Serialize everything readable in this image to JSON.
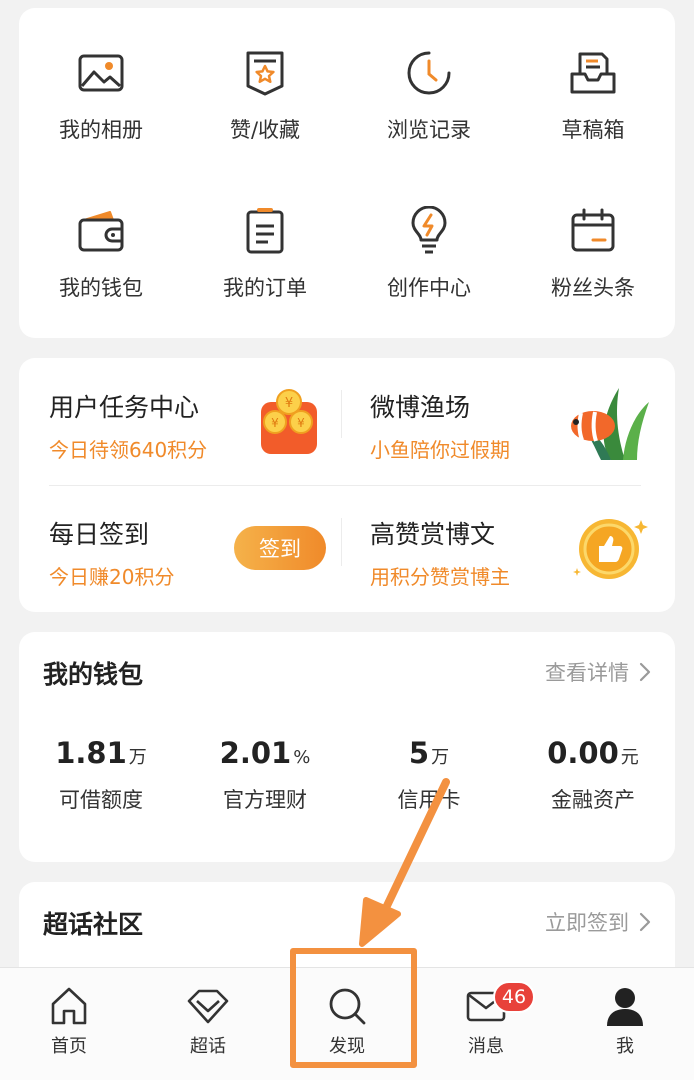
{
  "grid": {
    "items": [
      {
        "label": "我的相册",
        "icon": "photo-album-icon"
      },
      {
        "label": "赞/收藏",
        "icon": "like-favorite-icon"
      },
      {
        "label": "浏览记录",
        "icon": "history-icon"
      },
      {
        "label": "草稿箱",
        "icon": "drafts-icon"
      },
      {
        "label": "我的钱包",
        "icon": "wallet-icon"
      },
      {
        "label": "我的订单",
        "icon": "orders-icon"
      },
      {
        "label": "创作中心",
        "icon": "creator-center-icon"
      },
      {
        "label": "粉丝头条",
        "icon": "fans-headline-icon"
      }
    ]
  },
  "tasks": {
    "user_task": {
      "title": "用户任务中心",
      "subtitle": "今日待领640积分",
      "icon": "coins-icon"
    },
    "fishing": {
      "title": "微博渔场",
      "subtitle": "小鱼陪你过假期",
      "icon": "fish-icon"
    },
    "checkin": {
      "title": "每日签到",
      "subtitle": "今日赚20积分",
      "button": "签到"
    },
    "reward": {
      "title": "高赞赏博文",
      "subtitle": "用积分赞赏博主",
      "icon": "thumbs-up-coin-icon"
    }
  },
  "wallet": {
    "title": "我的钱包",
    "link": "查看详情",
    "stats": [
      {
        "value": "1.81",
        "unit": "万",
        "label": "可借额度"
      },
      {
        "value": "2.01",
        "unit": "%",
        "label": "官方理财"
      },
      {
        "value": "5",
        "unit": "万",
        "label": "信用卡"
      },
      {
        "value": "0.00",
        "unit": "元",
        "label": "金融资产"
      }
    ]
  },
  "topic": {
    "title": "超话社区",
    "link": "立即签到"
  },
  "nav": {
    "items": [
      {
        "label": "首页",
        "icon": "home-icon"
      },
      {
        "label": "超话",
        "icon": "diamond-icon"
      },
      {
        "label": "发现",
        "icon": "search-icon"
      },
      {
        "label": "消息",
        "icon": "message-icon",
        "badge": "46"
      },
      {
        "label": "我",
        "icon": "profile-icon"
      }
    ]
  },
  "colors": {
    "accent": "#f08a2a",
    "annotation": "#f39140",
    "badge": "#e8413a"
  }
}
